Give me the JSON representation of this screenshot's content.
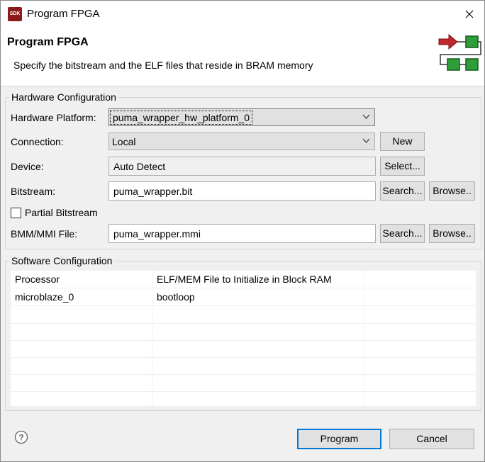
{
  "window": {
    "title": "Program FPGA",
    "icon_text": "SDK"
  },
  "banner": {
    "title": "Program FPGA",
    "description": "Specify the bitstream and the ELF files that reside in BRAM memory"
  },
  "hardware": {
    "group_label": "Hardware Configuration",
    "platform_label": "Hardware Platform:",
    "platform_value": "puma_wrapper_hw_platform_0",
    "connection_label": "Connection:",
    "connection_value": "Local",
    "new_button": "New",
    "device_label": "Device:",
    "device_value": "Auto Detect",
    "select_button": "Select...",
    "bitstream_label": "Bitstream:",
    "bitstream_value": "puma_wrapper.bit",
    "search_button": "Search...",
    "browse_button": "Browse..",
    "partial_label": "Partial Bitstream",
    "partial_checked": false,
    "bmm_label": "BMM/MMI File:",
    "bmm_value": "puma_wrapper.mmi"
  },
  "software": {
    "group_label": "Software Configuration",
    "columns": [
      "Processor",
      "ELF/MEM File to Initialize in Block RAM",
      ""
    ],
    "rows": [
      [
        "microblaze_0",
        "bootloop",
        ""
      ]
    ]
  },
  "footer": {
    "program_button": "Program",
    "cancel_button": "Cancel"
  },
  "colors": {
    "accent": "#0078d7",
    "arrow_red": "#c1272d",
    "box_green": "#2e9e3a"
  }
}
